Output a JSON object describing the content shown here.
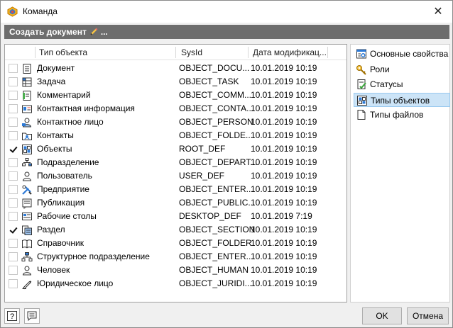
{
  "window": {
    "title": "Команда",
    "close_glyph": "✕"
  },
  "toolbar": {
    "create_label": "Создать документ",
    "ellipsis": "..."
  },
  "grid": {
    "columns": [
      "Тип объекта",
      "SysId",
      "Дата модификац..."
    ],
    "rows": [
      {
        "checked": false,
        "icon": "document-icon",
        "type": "Документ",
        "sysid": "OBJECT_DOCU...",
        "date": "10.01.2019 10:19"
      },
      {
        "checked": false,
        "icon": "task-icon",
        "type": "Задача",
        "sysid": "OBJECT_TASK",
        "date": "10.01.2019 10:19"
      },
      {
        "checked": false,
        "icon": "comment-icon",
        "type": "Комментарий",
        "sysid": "OBJECT_COMM...",
        "date": "10.01.2019 10:19"
      },
      {
        "checked": false,
        "icon": "contact-card-icon",
        "type": "Контактная информация",
        "sysid": "OBJECT_CONTA...",
        "date": "10.01.2019 10:19"
      },
      {
        "checked": false,
        "icon": "contact-person-icon",
        "type": "Контактное лицо",
        "sysid": "OBJECT_PERSON",
        "date": "10.01.2019 10:19"
      },
      {
        "checked": false,
        "icon": "contacts-folder-icon",
        "type": "Контакты",
        "sysid": "OBJECT_FOLDE...",
        "date": "10.01.2019 10:19"
      },
      {
        "checked": true,
        "icon": "objects-icon",
        "type": "Объекты",
        "sysid": "ROOT_DEF",
        "date": "10.01.2019 10:19"
      },
      {
        "checked": false,
        "icon": "department-icon",
        "type": "Подразделение",
        "sysid": "OBJECT_DEPART...",
        "date": "10.01.2019 10:19"
      },
      {
        "checked": false,
        "icon": "user-icon",
        "type": "Пользователь",
        "sysid": "USER_DEF",
        "date": "10.01.2019 10:19"
      },
      {
        "checked": false,
        "icon": "enterprise-icon",
        "type": "Предприятие",
        "sysid": "OBJECT_ENTER...",
        "date": "10.01.2019 10:19"
      },
      {
        "checked": false,
        "icon": "publication-icon",
        "type": "Публикация",
        "sysid": "OBJECT_PUBLIC...",
        "date": "10.01.2019 10:19"
      },
      {
        "checked": false,
        "icon": "desktop-icon",
        "type": "Рабочие столы",
        "sysid": "DESKTOP_DEF",
        "date": "10.01.2019 7:19"
      },
      {
        "checked": true,
        "icon": "section-icon",
        "type": "Раздел",
        "sysid": "OBJECT_SECTION",
        "date": "10.01.2019 10:19"
      },
      {
        "checked": false,
        "icon": "book-icon",
        "type": "Справочник",
        "sysid": "OBJECT_FOLDER",
        "date": "10.01.2019 10:19"
      },
      {
        "checked": false,
        "icon": "structure-icon",
        "type": "Структурное подразделение",
        "sysid": "OBJECT_ENTER...",
        "date": "10.01.2019 10:19"
      },
      {
        "checked": false,
        "icon": "human-icon",
        "type": "Человек",
        "sysid": "OBJECT_HUMAN",
        "date": "10.01.2019 10:19"
      },
      {
        "checked": false,
        "icon": "pen-icon",
        "type": "Юридическое лицо",
        "sysid": "OBJECT_JURIDI...",
        "date": "10.01.2019 10:19"
      }
    ]
  },
  "side_nav": {
    "items": [
      {
        "label": "Основные свойства",
        "icon": "properties-icon",
        "selected": false
      },
      {
        "label": "Роли",
        "icon": "roles-icon",
        "selected": false
      },
      {
        "label": "Статусы",
        "icon": "statuses-icon",
        "selected": false
      },
      {
        "label": "Типы объектов",
        "icon": "object-types-icon",
        "selected": true
      },
      {
        "label": "Типы файлов",
        "icon": "file-types-icon",
        "selected": false
      }
    ]
  },
  "footer": {
    "ok_label": "OK",
    "cancel_label": "Отмена",
    "help_glyph": "?"
  },
  "colors": {
    "toolbar_bg": "#6d6d6d",
    "selection": "#cce4f7",
    "checkbox_border": "#c8c8c8"
  }
}
